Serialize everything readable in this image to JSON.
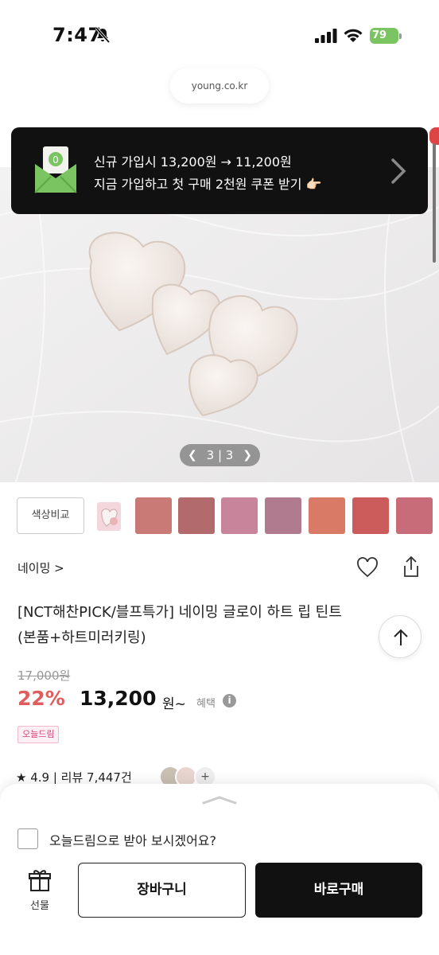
{
  "status_bar": {
    "time": "7:47",
    "battery": "79"
  },
  "browser": {
    "url": "young.co.kr"
  },
  "promo": {
    "line1": "신규 가입시 13,200원 → 11,200원",
    "line2": "지금 가입하고 첫 구매 2천원 쿠폰 받기 👉🏻",
    "accent": "#7ac461"
  },
  "gallery": {
    "current": "3",
    "total": "3"
  },
  "color_compare": {
    "label": "색상비교",
    "swatches": [
      "#c97a76",
      "#b36a6d",
      "#c8849a",
      "#b07a8f",
      "#d97a66",
      "#cc5c5c",
      "#c96c7a"
    ]
  },
  "product": {
    "brand": "네이밍 >",
    "title_line1": "[NCT해찬PICK/블프특가] 네이밍 글로이 하트 립 틴트",
    "title_line2": "(본품+하트미러키링)",
    "original_price": "17,000원",
    "discount": "22%",
    "price": "13,200",
    "price_unit": "원~",
    "benefit_label": "혜택",
    "badge": "오늘드림",
    "rating": "★ 4.9 | 리뷰 7,447건",
    "avatar_more": "+"
  },
  "bottom_sheet": {
    "delivery_question": "오늘드림으로 받아 보시겠어요?",
    "gift_label": "선물",
    "cart_label": "장바구니",
    "buy_label": "바로구매"
  }
}
